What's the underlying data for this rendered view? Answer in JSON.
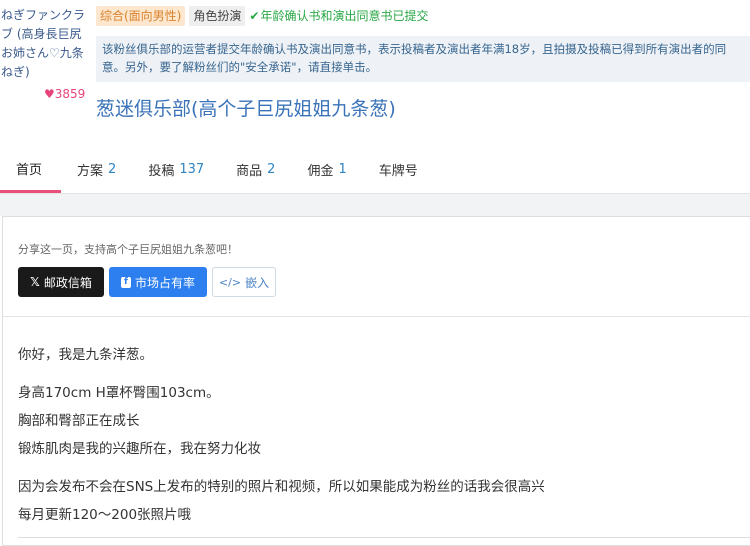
{
  "profile": {
    "avatar_text": "ねぎファンクラブ (高身長巨尻お姉さん♡九条ねぎ)",
    "likes": "3859"
  },
  "badges": {
    "category": "综合(面向男性)",
    "roleplay": "角色扮演",
    "consent": "年龄确认书和演出同意书已提交"
  },
  "notice": "该粉丝俱乐部的运营者提交年龄确认书及演出同意书，表示投稿者及演出者年满18岁，且拍摄及投稿已得到所有演出者的同意。另外，要了解粉丝们的\"安全承诺\"，请直接单击。",
  "page_title": "葱迷俱乐部(高个子巨尻姐姐九条葱)",
  "tabs": [
    {
      "label": "首页",
      "count": ""
    },
    {
      "label": "方案",
      "count": "2"
    },
    {
      "label": "投稿",
      "count": "137"
    },
    {
      "label": "商品",
      "count": "2"
    },
    {
      "label": "佣金",
      "count": "1"
    },
    {
      "label": "车牌号",
      "count": ""
    }
  ],
  "share": {
    "text": "分享这一页，支持高个子巨尻姐姐九条葱吧！",
    "x_label": "邮政信箱",
    "fb_label": "市场占有率",
    "embed_label": "嵌入"
  },
  "body": {
    "line1": "你好，我是九条洋葱。",
    "line2": "身高170cm H罩杯臀围103cm。",
    "line3": "胸部和臀部正在成长",
    "line4": "锻炼肌肉是我的兴趣所在，我在努力化妆",
    "line5": "因为会发布不会在SNS上发布的特别的照片和视频，所以如果能成为粉丝的话我会很高兴",
    "line6": "每月更新120～200张照片哦"
  },
  "colors": {
    "accent_pink": "#e84f7b",
    "link_blue": "#3b73b9",
    "success_green": "#28a745"
  }
}
